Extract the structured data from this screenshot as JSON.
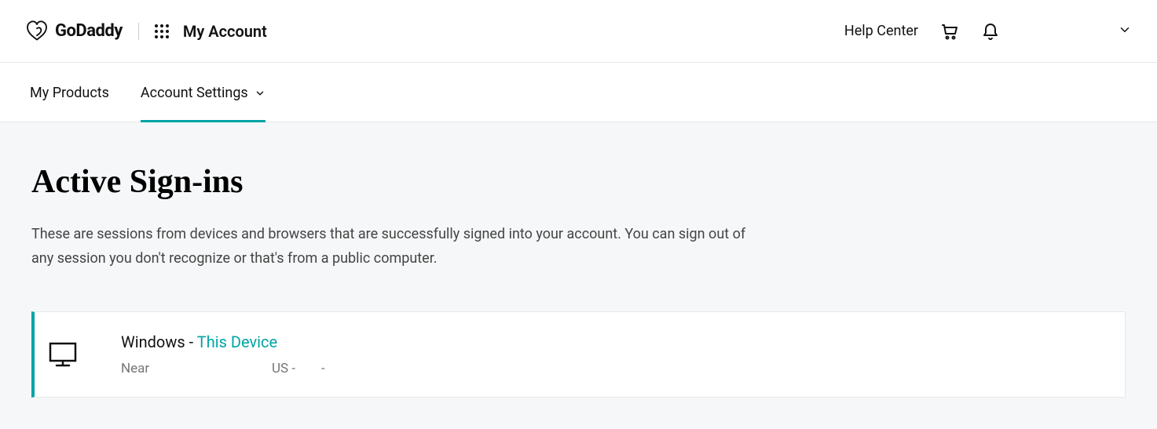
{
  "header": {
    "brand": "GoDaddy",
    "account_label": "My Account",
    "help_center": "Help Center"
  },
  "tabs": {
    "products": "My Products",
    "settings": "Account Settings"
  },
  "page": {
    "title": "Active Sign-ins",
    "description": "These are sessions from devices and browsers that are successfully signed into your account. You can sign out of any session you don't recognize or that's from a public computer."
  },
  "session": {
    "os": "Windows",
    "sep": " - ",
    "this_device": "This Device",
    "near": "Near",
    "country": "US -",
    "trailing": "-"
  }
}
